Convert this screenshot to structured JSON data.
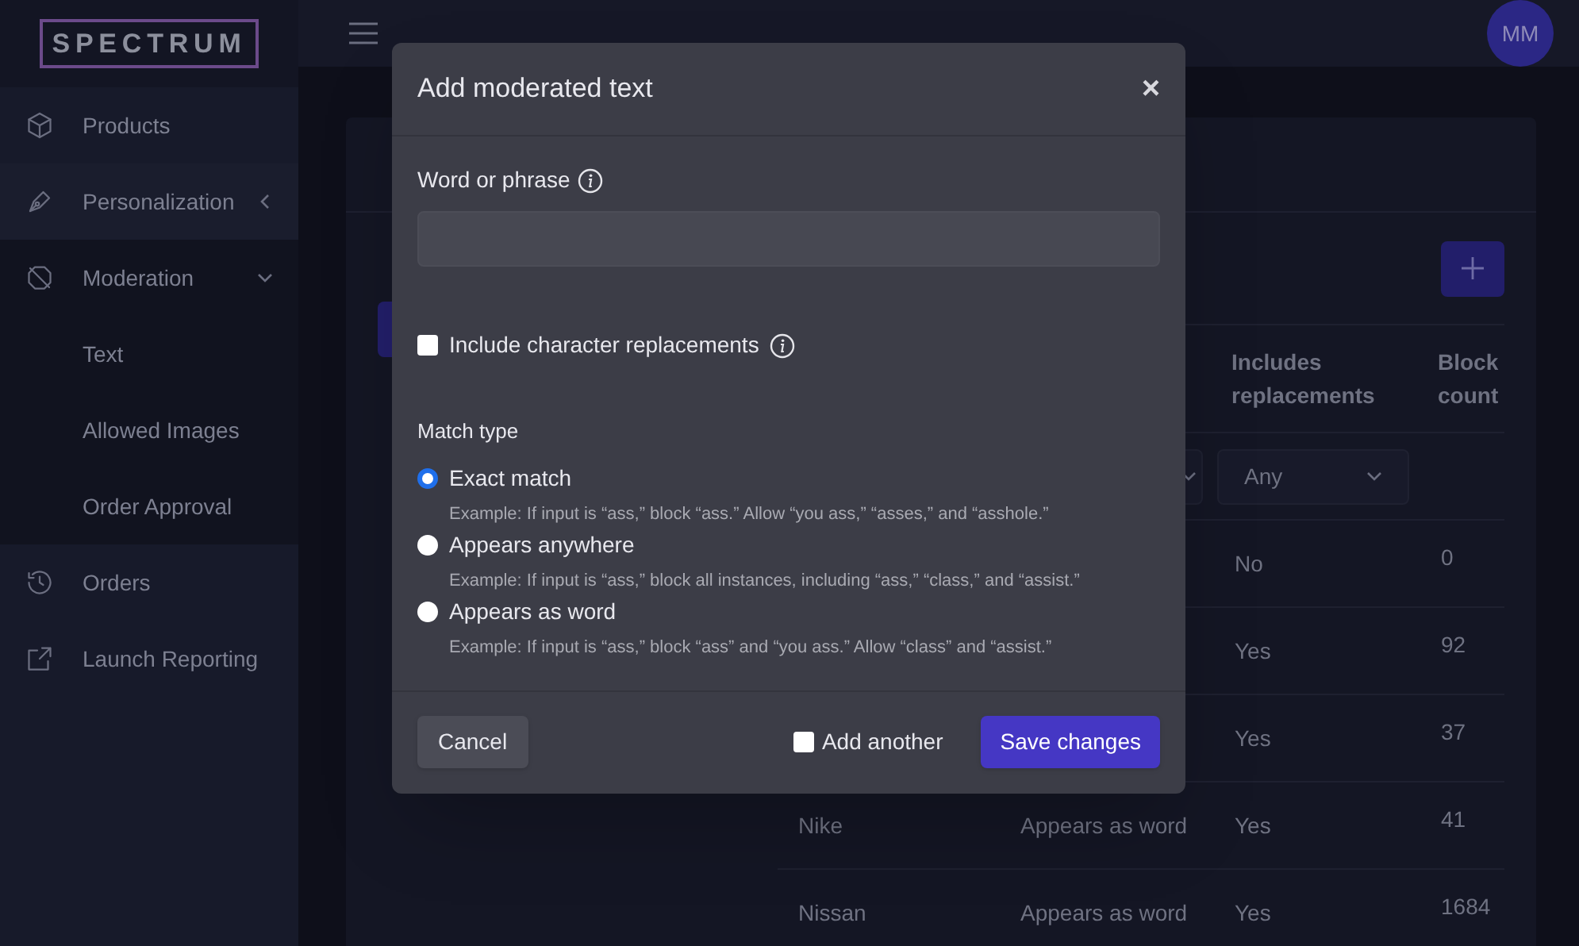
{
  "sidebar": {
    "logo": "SPECTRUM",
    "items": [
      {
        "label": "Products",
        "kind": "link"
      },
      {
        "label": "Personalization",
        "kind": "group",
        "expanded": false
      },
      {
        "label": "Moderation",
        "kind": "group",
        "expanded": true,
        "children": [
          {
            "label": "Text"
          },
          {
            "label": "Allowed Images"
          },
          {
            "label": "Order Approval"
          }
        ]
      },
      {
        "label": "Orders",
        "kind": "link"
      },
      {
        "label": "Launch Reporting",
        "kind": "link"
      }
    ]
  },
  "header": {
    "avatar": "MM"
  },
  "page": {
    "table": {
      "columns": [
        null,
        null,
        "Includes replacements",
        "Block count"
      ],
      "filter": {
        "value": "Any"
      },
      "rows": [
        {
          "cells": [
            null,
            null,
            "No",
            "0"
          ]
        },
        {
          "cells": [
            null,
            null,
            "Yes",
            "92"
          ]
        },
        {
          "cells": [
            null,
            null,
            "Yes",
            "37"
          ]
        },
        {
          "cells": [
            "Nike",
            "Appears as word",
            "Yes",
            "41"
          ]
        },
        {
          "cells": [
            "Nissan",
            "Appears as word",
            "Yes",
            "1684"
          ]
        }
      ]
    }
  },
  "modal": {
    "title": "Add moderated text",
    "close": "×",
    "word_label": "Word or phrase",
    "replacements": {
      "label": "Include character replacements",
      "checked": false
    },
    "match_type": {
      "label": "Match type",
      "options": [
        {
          "label": "Exact match",
          "selected": true,
          "example": "Example: If input is “ass,” block “ass.” Allow “you ass,” “asses,” and “asshole.”"
        },
        {
          "label": "Appears anywhere",
          "selected": false,
          "example": "Example: If input is “ass,” block all instances, including “ass,” “class,” and “assist.”"
        },
        {
          "label": "Appears as word",
          "selected": false,
          "example": "Example: If input is “ass,” block “ass” and “you ass.” Allow “class” and “assist.”"
        }
      ]
    },
    "cancel": "Cancel",
    "add_another": {
      "label": "Add another",
      "checked": false
    },
    "save": "Save changes"
  }
}
